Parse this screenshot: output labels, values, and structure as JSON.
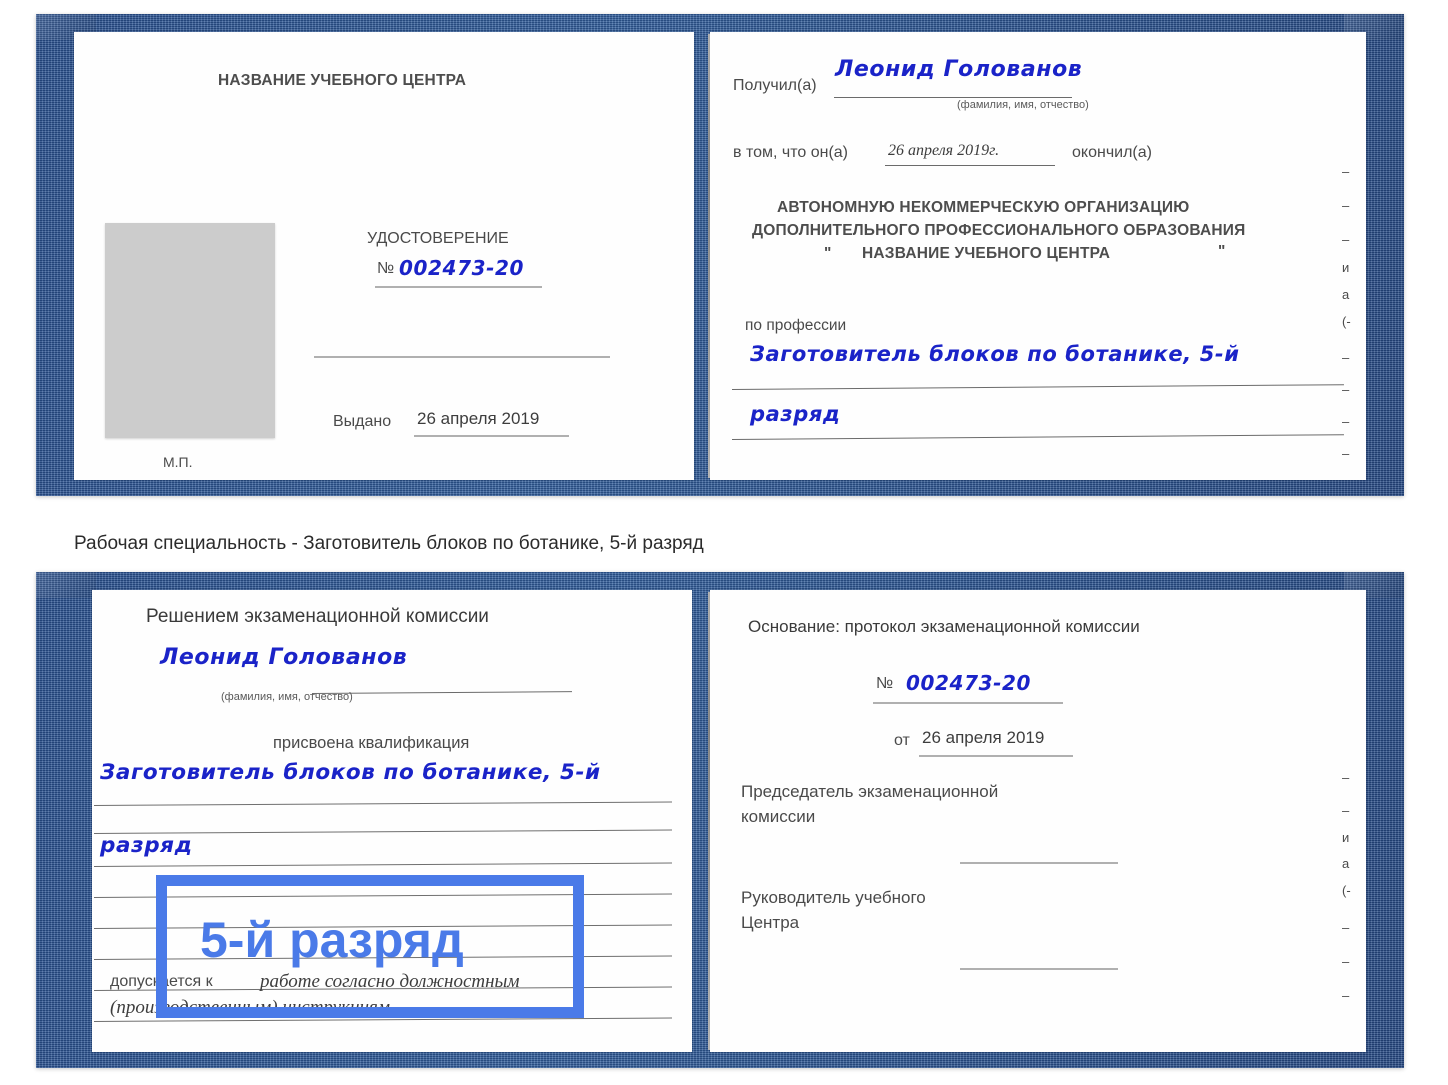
{
  "caption": "Рабочая специальность - Заготовитель блоков по ботанике, 5-й разряд",
  "highlight": {
    "label": "5-й разряд",
    "color": "#4a7ae8"
  },
  "cover": {
    "color": "#2e5898"
  },
  "ink": {
    "color": "#1a23c8"
  },
  "cert_top": {
    "left_page": {
      "center_title": "НАЗВАНИЕ УЧЕБНОГО ЦЕНТРА",
      "doc_type": "УДОСТОВЕРЕНИЕ",
      "number_prefix": "№",
      "number_value": "002473-20",
      "issued_label": "Выдано",
      "issued_value": "26 апреля 2019",
      "stamp_label": "М.П."
    },
    "right_page": {
      "received_label": "Получил(а)",
      "received_value": "Леонид Голованов",
      "fio_hint": "(фамилия, имя, отчество)",
      "that_he_label": "в том, что он(а)",
      "that_he_value": "26 апреля 2019г.",
      "finished_label": "окончил(а)",
      "org_line1": "АВТОНОМНУЮ НЕКОММЕРЧЕСКУЮ ОРГАНИЗАЦИЮ",
      "org_line2": "ДОПОЛНИТЕЛЬНОГО ПРОФЕССИОНАЛЬНОГО ОБРАЗОВАНИЯ",
      "org_quote_open": "\"",
      "org_name": "НАЗВАНИЕ УЧЕБНОГО ЦЕНТРА",
      "org_quote_close": "\"",
      "profession_label": "по профессии",
      "profession_value_line1": "Заготовитель блоков по ботанике, 5-й",
      "profession_value_line2": "разряд"
    }
  },
  "cert_bottom": {
    "left_page": {
      "decision_title": "Решением экзаменационной комиссии",
      "name_value": "Леонид Голованов",
      "fio_hint": "(фамилия, имя, отчество)",
      "qualification_label": "присвоена квалификация",
      "qualification_value_line1": "Заготовитель блоков по ботанике, 5-й",
      "qualification_value_line2": "разряд",
      "allowed_label": "допускается к",
      "allowed_value_line1": "работе согласно должностным",
      "allowed_value_line2": "(производственным) инструкциям"
    },
    "right_page": {
      "basis_label": "Основание: протокол экзаменационной комиссии",
      "number_prefix": "№",
      "number_value": "002473-20",
      "date_prefix": "от",
      "date_value": "26 апреля 2019",
      "chairman_line1": "Председатель экзаменационной",
      "chairman_line2": "комиссии",
      "head_line1": "Руководитель учебного",
      "head_line2": "Центра"
    }
  },
  "edge_fragments_top": [
    "–",
    "–",
    "–",
    "и",
    "а",
    "(-",
    "–",
    "–",
    "–",
    "–"
  ],
  "edge_fragments_bottom": [
    "–",
    "–",
    "и",
    "а",
    "(-",
    "–",
    "–",
    "–"
  ]
}
